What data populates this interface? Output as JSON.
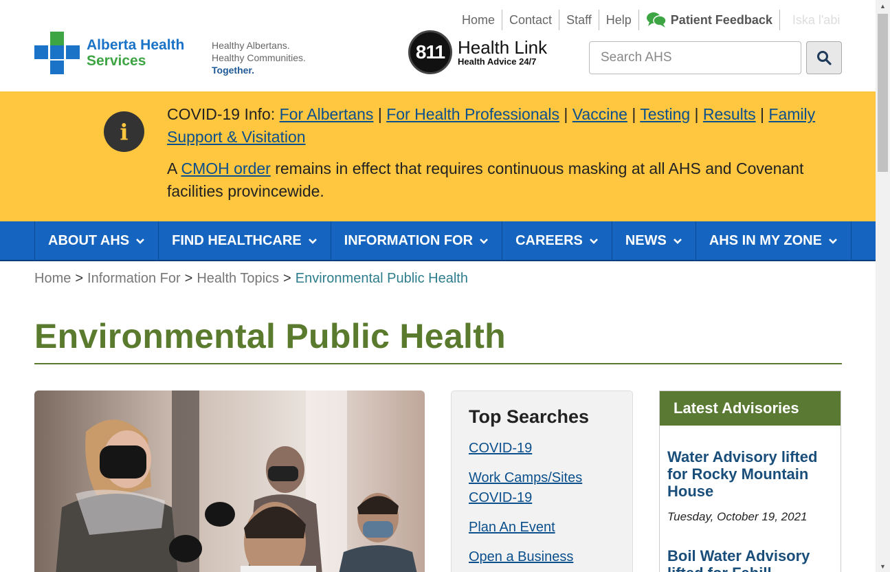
{
  "utility_nav": {
    "home": "Home",
    "contact": "Contact",
    "staff": "Staff",
    "help": "Help",
    "patient_feedback": "Patient Feedback",
    "language": "Iska l'abi"
  },
  "brand": {
    "name_line1": "Alberta Health",
    "name_line2": "Services",
    "tagline_line1": "Healthy Albertans.",
    "tagline_line2": "Healthy Communities.",
    "tagline_line3": "Together."
  },
  "health_link": {
    "number": "811",
    "title": "Health Link",
    "subtitle": "Health Advice 24/7"
  },
  "search": {
    "placeholder": "Search AHS"
  },
  "alert": {
    "prefix": "COVID-19 Info:",
    "links": [
      "For Albertans",
      "For Health Professionals",
      "Vaccine",
      "Testing",
      "Results",
      "Family Support & Visitation"
    ],
    "separator": "|",
    "notice_start": "A",
    "notice_link": "CMOH order",
    "notice_rest": "remains in effect that requires continuous masking at all AHS and Covenant facilities provincewide."
  },
  "main_nav": [
    "ABOUT AHS",
    "FIND HEALTHCARE",
    "INFORMATION FOR",
    "CAREERS",
    "NEWS",
    "AHS IN MY ZONE"
  ],
  "breadcrumb": {
    "home": "Home",
    "info_for": "Information For",
    "topics": "Health Topics",
    "current": "Environmental Public Health",
    "separator": ">"
  },
  "page_title": "Environmental Public Health",
  "top_searches": {
    "title": "Top Searches",
    "links": [
      "COVID-19",
      "Work Camps/Sites COVID-19",
      "Plan An Event",
      "Open a Business"
    ]
  },
  "advisories": {
    "title": "Latest Advisories",
    "items": [
      {
        "title": "Water Advisory lifted for Rocky Mountain House",
        "date": "Tuesday, October 19, 2021"
      },
      {
        "title": "Boil Water Advisory lifted for Fahill",
        "date": ""
      }
    ]
  },
  "colors": {
    "brand_blue": "#1565c0",
    "alert_yellow": "#ffc63f",
    "title_green": "#5a7a2e",
    "link_blue": "#0b4f8c"
  }
}
